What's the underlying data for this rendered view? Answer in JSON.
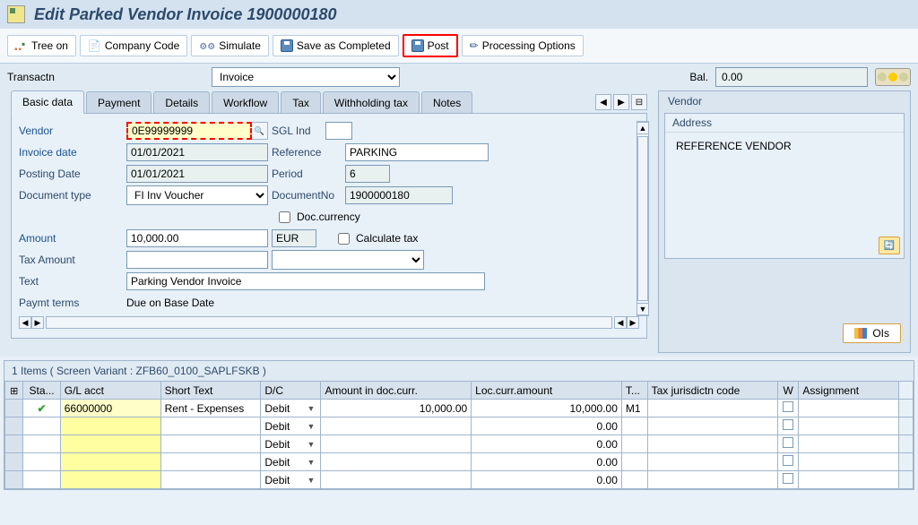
{
  "title": "Edit Parked Vendor Invoice 1900000180",
  "toolbar": {
    "tree_on": "Tree on",
    "company_code": "Company Code",
    "simulate": "Simulate",
    "save_completed": "Save as Completed",
    "post": "Post",
    "processing_options": "Processing Options"
  },
  "transaction": {
    "label": "Transactn",
    "value": "Invoice",
    "bal_label": "Bal.",
    "bal_value": "0.00"
  },
  "tabs": {
    "basic_data": "Basic data",
    "payment": "Payment",
    "details": "Details",
    "workflow": "Workflow",
    "tax": "Tax",
    "withholding": "Withholding tax",
    "notes": "Notes"
  },
  "form": {
    "vendor_label": "Vendor",
    "vendor_value": "0E99999999",
    "sgl_ind_label": "SGL Ind",
    "invoice_date_label": "Invoice date",
    "invoice_date_value": "01/01/2021",
    "reference_label": "Reference",
    "reference_value": "PARKING",
    "posting_date_label": "Posting Date",
    "posting_date_value": "01/01/2021",
    "period_label": "Period",
    "period_value": "6",
    "doc_type_label": "Document type",
    "doc_type_value": "FI Inv Voucher",
    "doc_no_label": "DocumentNo",
    "doc_no_value": "1900000180",
    "doc_currency_label": "Doc.currency",
    "amount_label": "Amount",
    "amount_value": "10,000.00",
    "currency_value": "EUR",
    "calc_tax_label": "Calculate tax",
    "tax_amount_label": "Tax Amount",
    "text_label": "Text",
    "text_value": "Parking Vendor Invoice",
    "pay_terms_label": "Paymt terms",
    "pay_terms_value": "Due on Base Date"
  },
  "vendor_panel": {
    "header": "Vendor",
    "address_label": "Address",
    "vendor_name": "REFERENCE VENDOR",
    "ois_label": "OIs"
  },
  "items": {
    "header": "1 Items ( Screen Variant : ZFB60_0100_SAPLFSKB )",
    "cols": {
      "status": "Sta...",
      "gl_acct": "G/L acct",
      "short_text": "Short Text",
      "dc": "D/C",
      "amount_doc": "Amount in doc.curr.",
      "loc_amount": "Loc.curr.amount",
      "tax": "T...",
      "tax_jur": "Tax jurisdictn code",
      "wh": "W",
      "assignment": "Assignment"
    },
    "rows": [
      {
        "status": "ok",
        "gl": "66000000",
        "st": "Rent - Expenses",
        "dc": "Debit",
        "amt": "10,000.00",
        "loc": "10,000.00",
        "tx": "M1"
      },
      {
        "status": "",
        "gl": "",
        "st": "",
        "dc": "Debit",
        "amt": "",
        "loc": "0.00",
        "tx": ""
      },
      {
        "status": "",
        "gl": "",
        "st": "",
        "dc": "Debit",
        "amt": "",
        "loc": "0.00",
        "tx": ""
      },
      {
        "status": "",
        "gl": "",
        "st": "",
        "dc": "Debit",
        "amt": "",
        "loc": "0.00",
        "tx": ""
      },
      {
        "status": "",
        "gl": "",
        "st": "",
        "dc": "Debit",
        "amt": "",
        "loc": "0.00",
        "tx": ""
      }
    ]
  }
}
